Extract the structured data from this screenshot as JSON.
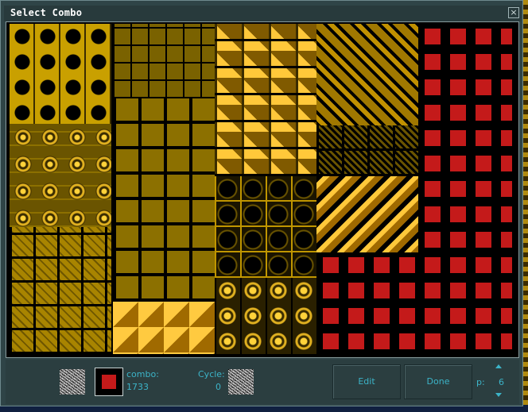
{
  "window": {
    "title": "Select Combo",
    "close_glyph": "×"
  },
  "tiles": {
    "red_color": "#c41a1a",
    "accent_gold": "#c9a000"
  },
  "panel": {
    "combo_label": "combo:",
    "combo_value": "1733",
    "cycle_label": "Cycle:",
    "cycle_value": "0",
    "edit_label": "Edit",
    "done_label": "Done",
    "page_label": "p:",
    "page_value": "6",
    "swatch_color": "#c41a1a",
    "icons": {
      "combo_preview": "noise-preview-icon",
      "cycle_preview": "noise-preview-icon",
      "page_up": "arrow-up-icon",
      "page_down": "arrow-down-icon"
    }
  }
}
